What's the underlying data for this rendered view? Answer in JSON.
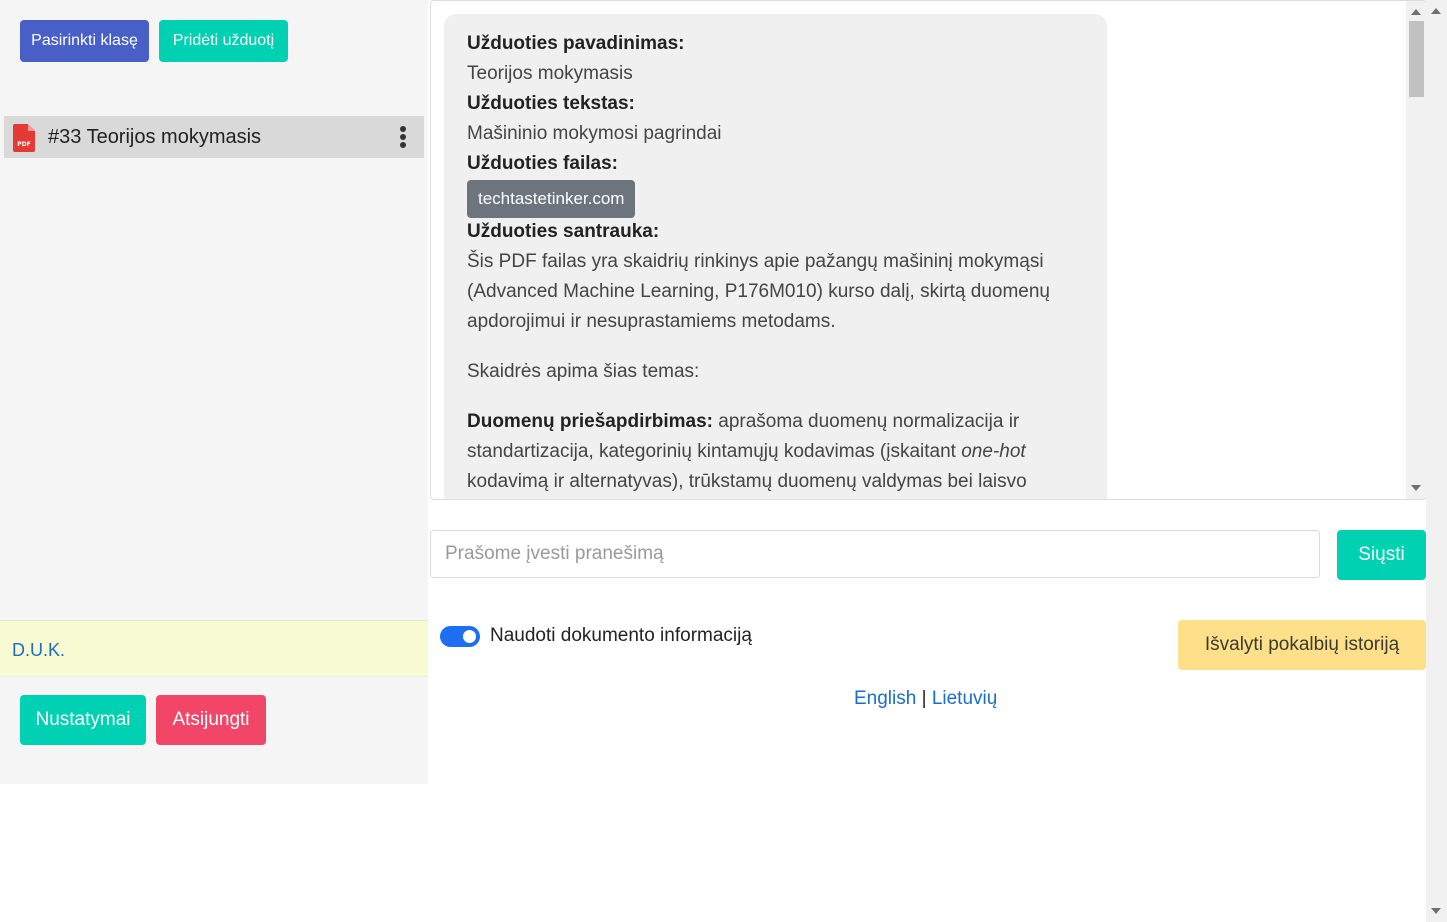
{
  "sidebar": {
    "select_class_label": "Pasirinkti klasę",
    "add_task_label": "Pridėti užduotį",
    "task_item": {
      "icon": "pdf-file-icon",
      "label": "#33 Teorijos mokymasis"
    },
    "faq_label": "D.U.K.",
    "settings_label": "Nustatymai",
    "logout_label": "Atsijungti"
  },
  "message": {
    "name_heading": "Užduoties pavadinimas:",
    "name_value": "Teorijos mokymasis",
    "text_heading": "Užduoties tekstas:",
    "text_value": "Mašininio mokymosi pagrindai",
    "file_heading": "Užduoties failas:",
    "file_value": "techtastetinker.com",
    "summary_heading": "Užduoties santrauka:",
    "summary_p1": "Šis PDF failas yra skaidrių rinkinys apie pažangų mašininį mokymąsi (Advanced Machine Learning, P176M010) kurso dalį, skirtą duomenų apdorojimui ir nesuprastamiems metodams.",
    "summary_p2": "Skaidrės apima šias temas:",
    "summary_p3_bold": "Duomenų priešapdirbimas:",
    "summary_p3_a": " aprašoma duomenų normalizacija ir standartizacija, kategorinių kintamųjų kodavimas (įskaitant ",
    "summary_p3_italic": "one-hot",
    "summary_p3_b": " kodavimą ir alternatyvas), trūkstamų duomenų valdymas bei laisvo"
  },
  "input": {
    "placeholder": "Prašome įvesti pranešimą",
    "value": ""
  },
  "send_label": "Siųsti",
  "toggle": {
    "label": "Naudoti dokumento informaciją",
    "checked": true
  },
  "clear_label": "Išvalyti pokalbių istoriją",
  "languages": {
    "english": "English",
    "separator": " | ",
    "lithuanian": "Lietuvių"
  },
  "colors": {
    "primary": "#485fc7",
    "success": "#00d1b2",
    "danger": "#f14668",
    "warning": "#ffe08a",
    "toggle_on": "#1d6ef1",
    "chip": "#6c757d"
  }
}
